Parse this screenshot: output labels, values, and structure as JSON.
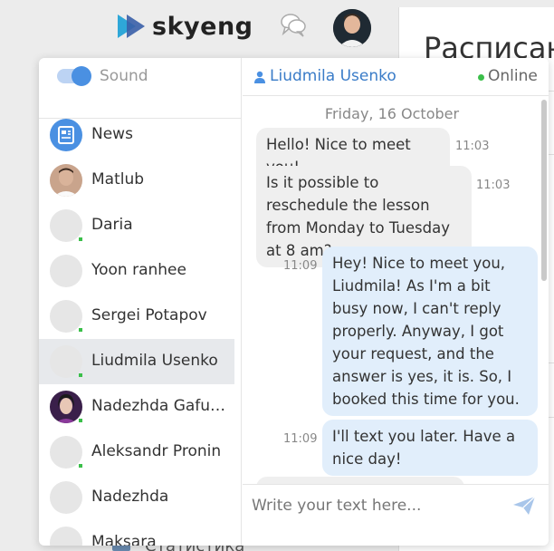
{
  "header": {
    "logo_text": "skyeng",
    "chat_icon": "chat-bubbles-icon",
    "avatar": "profile-avatar"
  },
  "background": {
    "card_title": "Расписан",
    "bottom_text": "Статистика"
  },
  "sidebar": {
    "sound_label": "Sound",
    "sound_enabled": true,
    "contacts": [
      {
        "name": "News",
        "icon": "news-icon",
        "online": false
      },
      {
        "name": "Matlub",
        "online": false
      },
      {
        "name": "Daria",
        "online": true
      },
      {
        "name": "Yoon ranhee",
        "online": false
      },
      {
        "name": "Sergei Potapov",
        "online": true
      },
      {
        "name": "Liudmila Usenko",
        "online": true,
        "active": true
      },
      {
        "name": "Nadezhda Gafu…",
        "online": true
      },
      {
        "name": "Aleksandr Pronin",
        "online": true
      },
      {
        "name": "Nadezhda",
        "online": false
      },
      {
        "name": "Maksara",
        "online": false
      }
    ]
  },
  "chat": {
    "user_name": "Liudmila Usenko",
    "status": "Online",
    "date": "Friday, 16 October",
    "messages": [
      {
        "text": "Hello! Nice to meet you!",
        "time": "11:03",
        "dir": "in"
      },
      {
        "text": "Is it possible to reschedule the lesson from Monday to Tuesday at 8 am?",
        "time": "11:03",
        "dir": "in"
      },
      {
        "text": "Hey! Nice to meet you, Liudmila! As I'm a bit busy now, I can't reply properly. Anyway, I got your request, and the answer is yes, it is. So, I booked this time for you.",
        "time": "11:09",
        "dir": "out"
      },
      {
        "text": "I'll text you later. Have a nice day!",
        "time": "11:09",
        "dir": "out"
      }
    ],
    "input_placeholder": "Write your text here...",
    "send_icon": "send-icon"
  },
  "colors": {
    "accent": "#4a90e2",
    "link": "#3a7cc8",
    "online": "#3bbf4a",
    "bubble_in": "#efefef",
    "bubble_out": "#e1eefb"
  }
}
